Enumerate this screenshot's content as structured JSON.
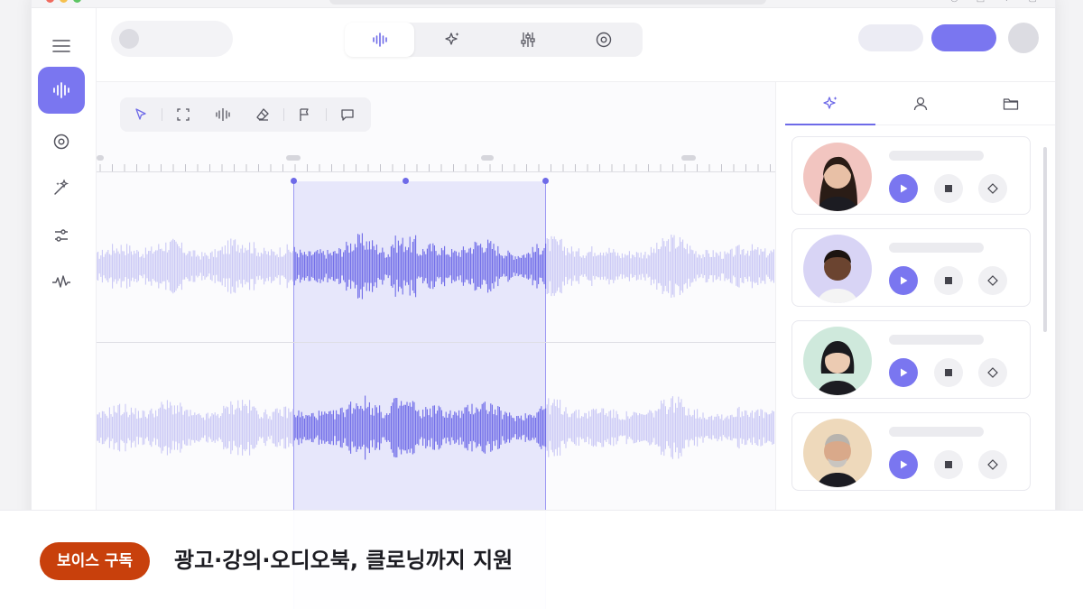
{
  "app": {
    "accent": "#7a76f0",
    "waveform_dim": "#c9c8f5",
    "waveform_active": "#6e6ae8"
  },
  "sidebar": {
    "items": [
      {
        "icon": "menu-icon"
      },
      {
        "icon": "waveform-icon",
        "active": true
      },
      {
        "icon": "target-icon"
      },
      {
        "icon": "magic-wand-icon"
      },
      {
        "icon": "sliders-icon"
      },
      {
        "icon": "pulse-icon"
      }
    ]
  },
  "topbar": {
    "tabs": [
      {
        "icon": "waveform-icon",
        "active": true
      },
      {
        "icon": "sparkle-icon"
      },
      {
        "icon": "mixer-icon"
      },
      {
        "icon": "target-icon"
      }
    ]
  },
  "toolbar": {
    "tools": [
      {
        "icon": "cursor-icon",
        "active": true
      },
      {
        "icon": "select-frame-icon"
      },
      {
        "icon": "split-icon"
      },
      {
        "icon": "eraser-icon"
      },
      {
        "icon": "flag-icon"
      },
      {
        "icon": "comment-icon"
      }
    ]
  },
  "right_panel": {
    "tabs": [
      {
        "icon": "sparkle-icon",
        "active": true
      },
      {
        "icon": "user-icon"
      },
      {
        "icon": "folder-icon"
      }
    ],
    "voices": [
      {
        "avatar": "woman-long-hair",
        "bg": "#f2c5c0"
      },
      {
        "avatar": "man-short-hair",
        "bg": "#d8d4f5"
      },
      {
        "avatar": "woman-bob-hair",
        "bg": "#cfe9dc"
      },
      {
        "avatar": "older-man-beard",
        "bg": "#eed9bb"
      }
    ]
  },
  "caption": {
    "badge": "보이스 구독",
    "headline": "광고·강의·오디오북, 클로닝까지 지원",
    "badge_color": "#c8400c"
  }
}
